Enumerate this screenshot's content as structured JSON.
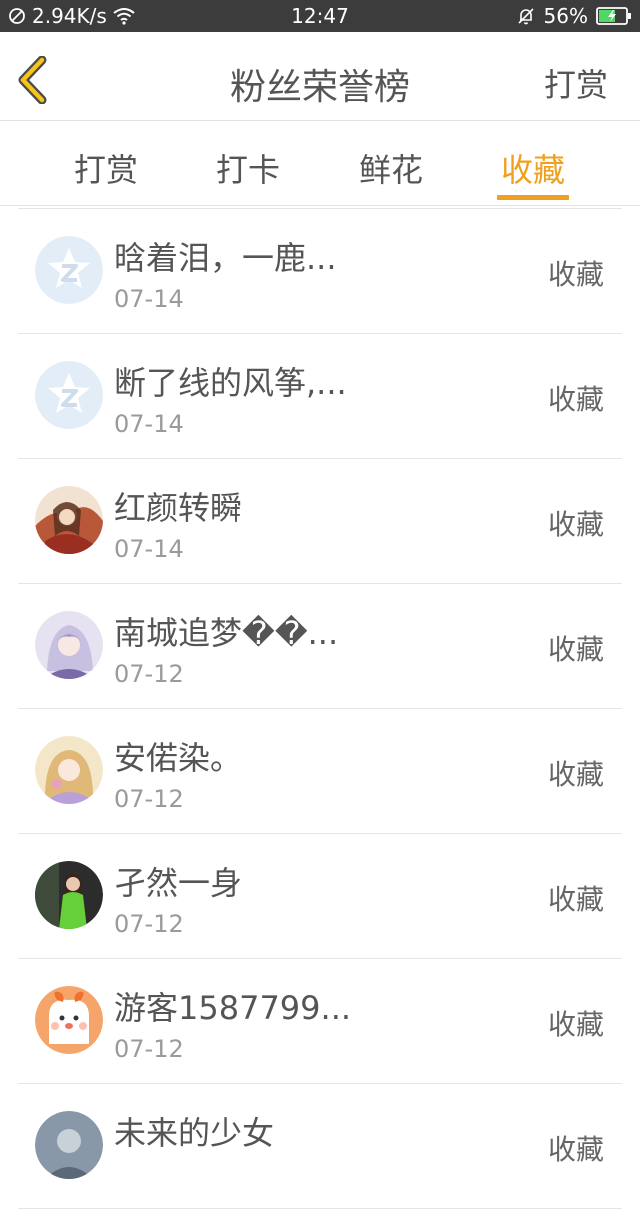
{
  "status_bar": {
    "net_speed": "2.94K/s",
    "time": "12:47",
    "battery": "56%"
  },
  "header": {
    "title": "粉丝荣誉榜",
    "right_action": "打赏"
  },
  "tabs": [
    {
      "label": "打赏",
      "active": false
    },
    {
      "label": "打卡",
      "active": false
    },
    {
      "label": "鲜花",
      "active": false
    },
    {
      "label": "收藏",
      "active": true
    }
  ],
  "colors": {
    "accent": "#f0a020",
    "status_bar_bg": "#3c3c3c"
  },
  "list": [
    {
      "name": "晗着泪，一鹿...",
      "date": "07-14",
      "action": "收藏",
      "avatar": "default-avatar-icon"
    },
    {
      "name": "断了线的风筝,...",
      "date": "07-14",
      "action": "收藏",
      "avatar": "default-avatar-icon"
    },
    {
      "name": "红颜转瞬",
      "date": "07-14",
      "action": "收藏",
      "avatar": "user-photo"
    },
    {
      "name": "南城追梦��...",
      "date": "07-12",
      "action": "收藏",
      "avatar": "user-photo"
    },
    {
      "name": "安偌染。",
      "date": "07-12",
      "action": "收藏",
      "avatar": "user-photo"
    },
    {
      "name": "孑然一身",
      "date": "07-12",
      "action": "收藏",
      "avatar": "user-photo"
    },
    {
      "name": "游客1587799...",
      "date": "07-12",
      "action": "收藏",
      "avatar": "user-photo"
    },
    {
      "name": "未来的少女",
      "date": "",
      "action": "收藏",
      "avatar": "user-photo"
    }
  ]
}
